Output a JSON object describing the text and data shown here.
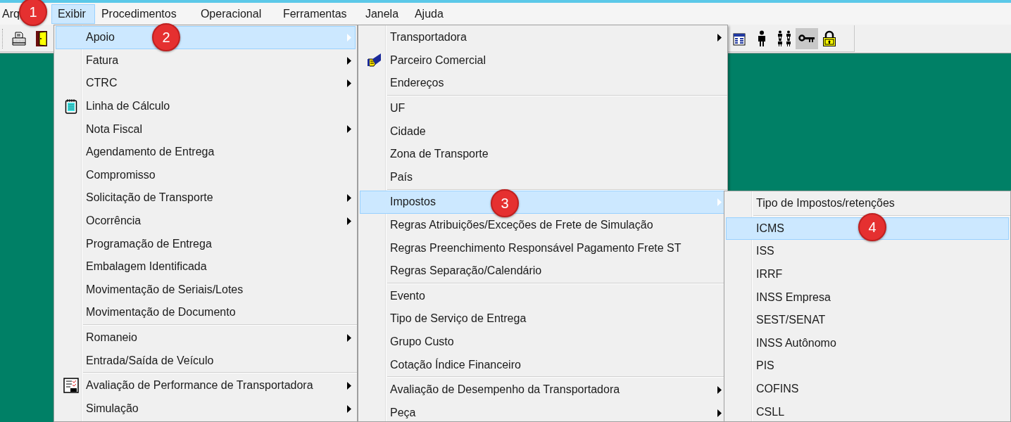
{
  "menubar": [
    {
      "label": "Arq",
      "selected": false
    },
    {
      "label": "Exibir",
      "selected": true
    },
    {
      "label": "Procedimentos",
      "selected": false
    },
    {
      "label": "Operacional",
      "selected": false
    },
    {
      "label": "Ferramentas",
      "selected": false
    },
    {
      "label": "Janela",
      "selected": false
    },
    {
      "label": "Ajuda",
      "selected": false
    }
  ],
  "toolbar": [
    {
      "pressed": false
    },
    {
      "pressed": false
    },
    {
      "pressed": false
    },
    {
      "pressed": false
    },
    {
      "pressed": false
    },
    {
      "pressed": true
    },
    {
      "pressed": false
    }
  ],
  "menus": [
    {
      "items": [
        {
          "kind": "item",
          "label": "Apoio",
          "submenu": true,
          "selected": true,
          "has_icon": false
        },
        {
          "kind": "item",
          "label": "Fatura",
          "submenu": true,
          "selected": false,
          "has_icon": false
        },
        {
          "kind": "item",
          "label": "CTRC",
          "submenu": true,
          "selected": false,
          "has_icon": false
        },
        {
          "kind": "item",
          "label": "Linha de Cálculo",
          "submenu": false,
          "selected": false,
          "has_icon": true
        },
        {
          "kind": "item",
          "label": "Nota Fiscal",
          "submenu": true,
          "selected": false,
          "has_icon": false
        },
        {
          "kind": "item",
          "label": "Agendamento de Entrega",
          "submenu": false,
          "selected": false,
          "has_icon": false
        },
        {
          "kind": "item",
          "label": "Compromisso",
          "submenu": false,
          "selected": false,
          "has_icon": false
        },
        {
          "kind": "item",
          "label": "Solicitação de Transporte",
          "submenu": true,
          "selected": false,
          "has_icon": false
        },
        {
          "kind": "item",
          "label": "Ocorrência",
          "submenu": true,
          "selected": false,
          "has_icon": false
        },
        {
          "kind": "item",
          "label": "Programação de Entrega",
          "submenu": false,
          "selected": false,
          "has_icon": false
        },
        {
          "kind": "item",
          "label": "Embalagem Identificada",
          "submenu": false,
          "selected": false,
          "has_icon": false
        },
        {
          "kind": "item",
          "label": "Movimentação de Seriais/Lotes",
          "submenu": false,
          "selected": false,
          "has_icon": false
        },
        {
          "kind": "item",
          "label": "Movimentação de Documento",
          "submenu": false,
          "selected": false,
          "has_icon": false
        },
        {
          "kind": "separator"
        },
        {
          "kind": "item",
          "label": "Romaneio",
          "submenu": true,
          "selected": false,
          "has_icon": false
        },
        {
          "kind": "item",
          "label": "Entrada/Saída de Veículo",
          "submenu": false,
          "selected": false,
          "has_icon": false
        },
        {
          "kind": "separator"
        },
        {
          "kind": "item",
          "label": "Avaliação de Performance de Transportadora",
          "submenu": true,
          "selected": false,
          "has_icon": true
        },
        {
          "kind": "item",
          "label": "Simulação",
          "submenu": true,
          "selected": false,
          "has_icon": false
        }
      ]
    },
    {
      "items": [
        {
          "kind": "item",
          "label": "Transportadora",
          "submenu": true,
          "selected": false,
          "has_icon": false
        },
        {
          "kind": "item",
          "label": "Parceiro Comercial",
          "submenu": false,
          "selected": false,
          "has_icon": true
        },
        {
          "kind": "item",
          "label": "Endereços",
          "submenu": false,
          "selected": false,
          "has_icon": false
        },
        {
          "kind": "separator"
        },
        {
          "kind": "item",
          "label": "UF",
          "submenu": false,
          "selected": false,
          "has_icon": false
        },
        {
          "kind": "item",
          "label": "Cidade",
          "submenu": false,
          "selected": false,
          "has_icon": false
        },
        {
          "kind": "item",
          "label": "Zona de Transporte",
          "submenu": false,
          "selected": false,
          "has_icon": false
        },
        {
          "kind": "item",
          "label": "País",
          "submenu": false,
          "selected": false,
          "has_icon": false
        },
        {
          "kind": "separator"
        },
        {
          "kind": "item",
          "label": "Impostos",
          "submenu": true,
          "selected": true,
          "has_icon": false
        },
        {
          "kind": "item",
          "label": "Regras Atribuições/Exceções de Frete de Simulação",
          "submenu": false,
          "selected": false,
          "has_icon": false
        },
        {
          "kind": "item",
          "label": "Regras Preenchimento Responsável Pagamento Frete ST",
          "submenu": false,
          "selected": false,
          "has_icon": false
        },
        {
          "kind": "item",
          "label": "Regras Separação/Calendário",
          "submenu": false,
          "selected": false,
          "has_icon": false
        },
        {
          "kind": "separator"
        },
        {
          "kind": "item",
          "label": "Evento",
          "submenu": false,
          "selected": false,
          "has_icon": false
        },
        {
          "kind": "item",
          "label": "Tipo de Serviço de Entrega",
          "submenu": false,
          "selected": false,
          "has_icon": false
        },
        {
          "kind": "item",
          "label": "Grupo Custo",
          "submenu": false,
          "selected": false,
          "has_icon": false
        },
        {
          "kind": "item",
          "label": "Cotação Índice Financeiro",
          "submenu": false,
          "selected": false,
          "has_icon": false
        },
        {
          "kind": "separator"
        },
        {
          "kind": "item",
          "label": "Avaliação de Desempenho da Transportadora",
          "submenu": true,
          "selected": false,
          "has_icon": false
        },
        {
          "kind": "item",
          "label": "Peça",
          "submenu": true,
          "selected": false,
          "has_icon": false
        }
      ]
    },
    {
      "items": [
        {
          "kind": "item",
          "label": "Tipo de Impostos/retenções",
          "submenu": false,
          "selected": false,
          "has_icon": false
        },
        {
          "kind": "separator"
        },
        {
          "kind": "item",
          "label": "ICMS",
          "submenu": false,
          "selected": true,
          "has_icon": false
        },
        {
          "kind": "item",
          "label": "ISS",
          "submenu": false,
          "selected": false,
          "has_icon": false
        },
        {
          "kind": "item",
          "label": "IRRF",
          "submenu": false,
          "selected": false,
          "has_icon": false
        },
        {
          "kind": "item",
          "label": "INSS Empresa",
          "submenu": false,
          "selected": false,
          "has_icon": false
        },
        {
          "kind": "item",
          "label": "SEST/SENAT",
          "submenu": false,
          "selected": false,
          "has_icon": false
        },
        {
          "kind": "item",
          "label": "INSS Autônomo",
          "submenu": false,
          "selected": false,
          "has_icon": false
        },
        {
          "kind": "item",
          "label": "PIS",
          "submenu": false,
          "selected": false,
          "has_icon": false
        },
        {
          "kind": "item",
          "label": "COFINS",
          "submenu": false,
          "selected": false,
          "has_icon": false
        },
        {
          "kind": "item",
          "label": "CSLL",
          "submenu": false,
          "selected": false,
          "has_icon": false
        }
      ]
    }
  ],
  "callouts": [
    "1",
    "2",
    "3",
    "4"
  ]
}
